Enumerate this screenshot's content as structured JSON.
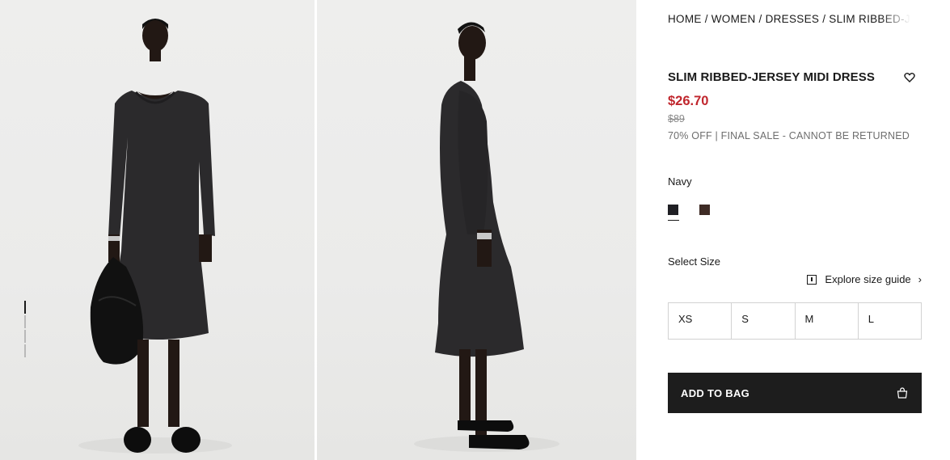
{
  "breadcrumb": {
    "items": [
      "HOME",
      "WOMEN",
      "DRESSES",
      "SLIM RIBBED-JERSEY MIDI DRESS"
    ],
    "separator": "/"
  },
  "product": {
    "title": "SLIM RIBBED-JERSEY MIDI DRESS",
    "price": "$26.70",
    "original_price": "$89",
    "sale_note": "70% OFF | FINAL SALE - CANNOT BE RETURNED",
    "wishlist_icon": "heart-icon"
  },
  "color": {
    "selected_label": "Navy",
    "swatches": [
      "#1f1f24",
      "#3e2b25"
    ],
    "selected_index": 0
  },
  "size": {
    "label": "Select Size",
    "guide_label": "Explore size guide",
    "options": [
      "XS",
      "S",
      "M",
      "L"
    ]
  },
  "cart": {
    "add_label": "ADD TO BAG",
    "icon": "shopping-bag-icon"
  },
  "gallery": {
    "image_count": 4,
    "active_index": 0,
    "colors": {
      "dress": "#2b2a2c",
      "skin": "#231915",
      "bag": "#111111"
    }
  }
}
